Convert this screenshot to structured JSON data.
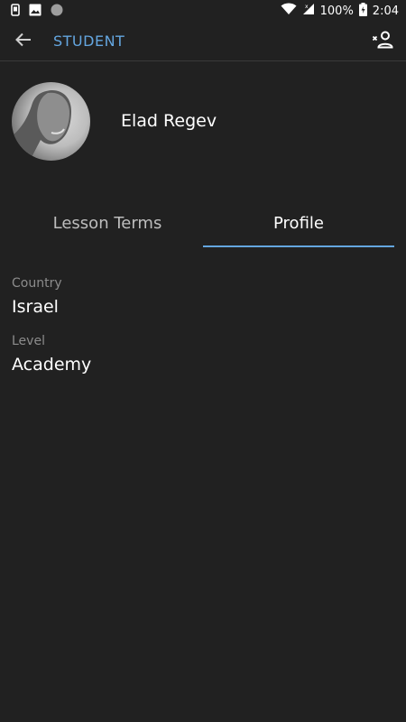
{
  "status_bar": {
    "battery": "100%",
    "time": "2:04"
  },
  "app_bar": {
    "title": "STUDENT",
    "back_icon": "arrow-back-icon",
    "remove_icon": "person-remove-icon"
  },
  "profile": {
    "name": "Elad Regev"
  },
  "tabs": [
    {
      "label": "Lesson Terms",
      "active": false
    },
    {
      "label": "Profile",
      "active": true
    }
  ],
  "fields": [
    {
      "label": "Country",
      "value": "Israel"
    },
    {
      "label": "Level",
      "value": "Academy"
    }
  ],
  "colors": {
    "background": "#212121",
    "accent": "#64a6e0",
    "label": "#8c8c8c"
  }
}
